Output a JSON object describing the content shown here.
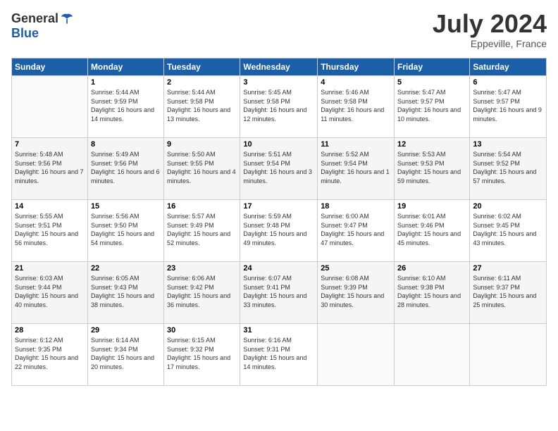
{
  "header": {
    "logo_general": "General",
    "logo_blue": "Blue",
    "month_title": "July 2024",
    "subtitle": "Eppeville, France"
  },
  "days_of_week": [
    "Sunday",
    "Monday",
    "Tuesday",
    "Wednesday",
    "Thursday",
    "Friday",
    "Saturday"
  ],
  "weeks": [
    [
      {
        "day": "",
        "sunrise": "",
        "sunset": "",
        "daylight": ""
      },
      {
        "day": "1",
        "sunrise": "5:44 AM",
        "sunset": "9:59 PM",
        "daylight": "16 hours and 14 minutes."
      },
      {
        "day": "2",
        "sunrise": "5:44 AM",
        "sunset": "9:58 PM",
        "daylight": "16 hours and 13 minutes."
      },
      {
        "day": "3",
        "sunrise": "5:45 AM",
        "sunset": "9:58 PM",
        "daylight": "16 hours and 12 minutes."
      },
      {
        "day": "4",
        "sunrise": "5:46 AM",
        "sunset": "9:58 PM",
        "daylight": "16 hours and 11 minutes."
      },
      {
        "day": "5",
        "sunrise": "5:47 AM",
        "sunset": "9:57 PM",
        "daylight": "16 hours and 10 minutes."
      },
      {
        "day": "6",
        "sunrise": "5:47 AM",
        "sunset": "9:57 PM",
        "daylight": "16 hours and 9 minutes."
      }
    ],
    [
      {
        "day": "7",
        "sunrise": "5:48 AM",
        "sunset": "9:56 PM",
        "daylight": "16 hours and 7 minutes."
      },
      {
        "day": "8",
        "sunrise": "5:49 AM",
        "sunset": "9:56 PM",
        "daylight": "16 hours and 6 minutes."
      },
      {
        "day": "9",
        "sunrise": "5:50 AM",
        "sunset": "9:55 PM",
        "daylight": "16 hours and 4 minutes."
      },
      {
        "day": "10",
        "sunrise": "5:51 AM",
        "sunset": "9:54 PM",
        "daylight": "16 hours and 3 minutes."
      },
      {
        "day": "11",
        "sunrise": "5:52 AM",
        "sunset": "9:54 PM",
        "daylight": "16 hours and 1 minute."
      },
      {
        "day": "12",
        "sunrise": "5:53 AM",
        "sunset": "9:53 PM",
        "daylight": "15 hours and 59 minutes."
      },
      {
        "day": "13",
        "sunrise": "5:54 AM",
        "sunset": "9:52 PM",
        "daylight": "15 hours and 57 minutes."
      }
    ],
    [
      {
        "day": "14",
        "sunrise": "5:55 AM",
        "sunset": "9:51 PM",
        "daylight": "15 hours and 56 minutes."
      },
      {
        "day": "15",
        "sunrise": "5:56 AM",
        "sunset": "9:50 PM",
        "daylight": "15 hours and 54 minutes."
      },
      {
        "day": "16",
        "sunrise": "5:57 AM",
        "sunset": "9:49 PM",
        "daylight": "15 hours and 52 minutes."
      },
      {
        "day": "17",
        "sunrise": "5:59 AM",
        "sunset": "9:48 PM",
        "daylight": "15 hours and 49 minutes."
      },
      {
        "day": "18",
        "sunrise": "6:00 AM",
        "sunset": "9:47 PM",
        "daylight": "15 hours and 47 minutes."
      },
      {
        "day": "19",
        "sunrise": "6:01 AM",
        "sunset": "9:46 PM",
        "daylight": "15 hours and 45 minutes."
      },
      {
        "day": "20",
        "sunrise": "6:02 AM",
        "sunset": "9:45 PM",
        "daylight": "15 hours and 43 minutes."
      }
    ],
    [
      {
        "day": "21",
        "sunrise": "6:03 AM",
        "sunset": "9:44 PM",
        "daylight": "15 hours and 40 minutes."
      },
      {
        "day": "22",
        "sunrise": "6:05 AM",
        "sunset": "9:43 PM",
        "daylight": "15 hours and 38 minutes."
      },
      {
        "day": "23",
        "sunrise": "6:06 AM",
        "sunset": "9:42 PM",
        "daylight": "15 hours and 36 minutes."
      },
      {
        "day": "24",
        "sunrise": "6:07 AM",
        "sunset": "9:41 PM",
        "daylight": "15 hours and 33 minutes."
      },
      {
        "day": "25",
        "sunrise": "6:08 AM",
        "sunset": "9:39 PM",
        "daylight": "15 hours and 30 minutes."
      },
      {
        "day": "26",
        "sunrise": "6:10 AM",
        "sunset": "9:38 PM",
        "daylight": "15 hours and 28 minutes."
      },
      {
        "day": "27",
        "sunrise": "6:11 AM",
        "sunset": "9:37 PM",
        "daylight": "15 hours and 25 minutes."
      }
    ],
    [
      {
        "day": "28",
        "sunrise": "6:12 AM",
        "sunset": "9:35 PM",
        "daylight": "15 hours and 22 minutes."
      },
      {
        "day": "29",
        "sunrise": "6:14 AM",
        "sunset": "9:34 PM",
        "daylight": "15 hours and 20 minutes."
      },
      {
        "day": "30",
        "sunrise": "6:15 AM",
        "sunset": "9:32 PM",
        "daylight": "15 hours and 17 minutes."
      },
      {
        "day": "31",
        "sunrise": "6:16 AM",
        "sunset": "9:31 PM",
        "daylight": "15 hours and 14 minutes."
      },
      {
        "day": "",
        "sunrise": "",
        "sunset": "",
        "daylight": ""
      },
      {
        "day": "",
        "sunrise": "",
        "sunset": "",
        "daylight": ""
      },
      {
        "day": "",
        "sunrise": "",
        "sunset": "",
        "daylight": ""
      }
    ]
  ]
}
